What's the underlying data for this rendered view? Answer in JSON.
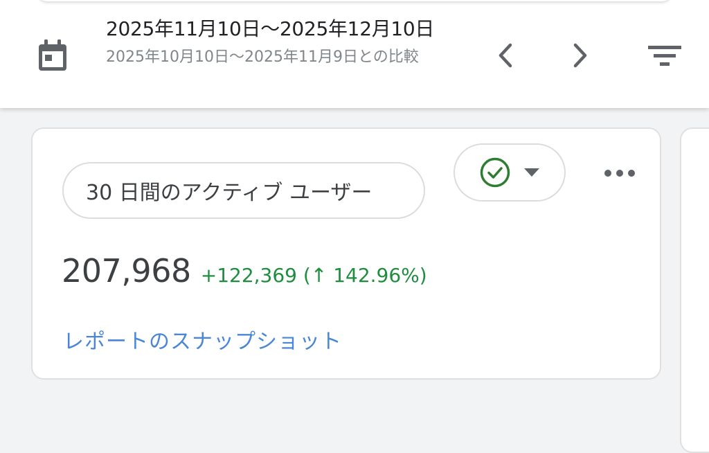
{
  "header": {
    "date_range": "2025年11月10日〜2025年12月10日",
    "comparison": "2025年10月10日〜2025年11月9日との比較",
    "icons": {
      "calendar": "calendar-icon",
      "prev": "chevron-left-icon",
      "next": "chevron-right-icon",
      "filter": "filter-icon"
    }
  },
  "card": {
    "metric_label": "30 日間のアクティブ ユーザー",
    "status_icon": "check-circle-icon",
    "value": "207,968",
    "change": "+122,369 (",
    "change_arrow": "↑",
    "change_percent": "142.96%)",
    "link": "レポートのスナップショット"
  },
  "colors": {
    "accent_link": "#4a86d8",
    "positive": "#1e8e3e",
    "check": "#2e7d32",
    "icon": "#5f6368",
    "background": "#f1f3f4"
  }
}
